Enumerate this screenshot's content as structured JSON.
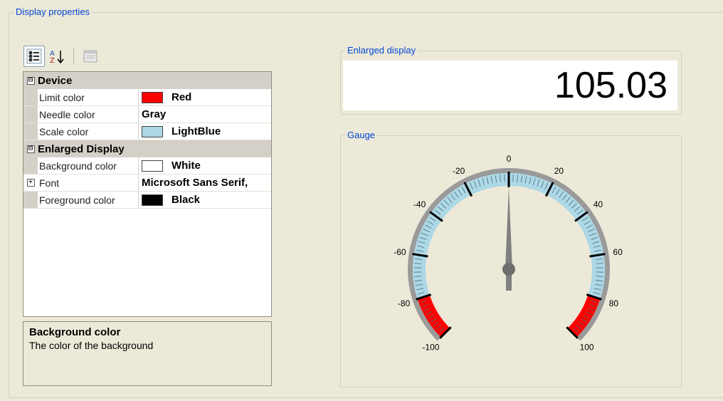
{
  "display_properties": {
    "title": "Display properties"
  },
  "toolbar": {
    "buttons": [
      {
        "icon": "categorized-icon",
        "active": true
      },
      {
        "icon": "alphabetical-sort-icon",
        "active": false
      },
      {
        "icon": "property-pages-icon",
        "active": false
      }
    ]
  },
  "property_grid": {
    "categories": [
      {
        "name": "Device",
        "expander": "⊟",
        "properties": [
          {
            "name": "Limit color",
            "value": "Red",
            "swatch": "#ff0000"
          },
          {
            "name": "Needle color",
            "value": "Gray",
            "swatch": null
          },
          {
            "name": "Scale color",
            "value": "LightBlue",
            "swatch": "#add8e6"
          }
        ]
      },
      {
        "name": "Enlarged Display",
        "expander": "⊟",
        "properties": [
          {
            "name": "Background color",
            "value": "White",
            "swatch": "#ffffff",
            "selected": true
          },
          {
            "name": "Font",
            "value": "Microsoft Sans Serif,",
            "swatch": null,
            "expander": "+"
          },
          {
            "name": "Foreground color",
            "value": "Black",
            "swatch": "#000000"
          }
        ]
      }
    ]
  },
  "help": {
    "title": "Background color",
    "text": "The color of the background"
  },
  "enlarged_display": {
    "title": "Enlarged display",
    "value": "105.03"
  },
  "gauge": {
    "title": "Gauge",
    "min": -100,
    "max": 100,
    "value": 0,
    "tick_labels": [
      "-100",
      "-80",
      "-60",
      "-40",
      "-20",
      "0",
      "20",
      "40",
      "60",
      "80",
      "100"
    ],
    "limit_low": -80,
    "limit_high": 80,
    "colors": {
      "scale": "#add8e6",
      "limit": "#ff0000",
      "needle": "#808080"
    }
  }
}
